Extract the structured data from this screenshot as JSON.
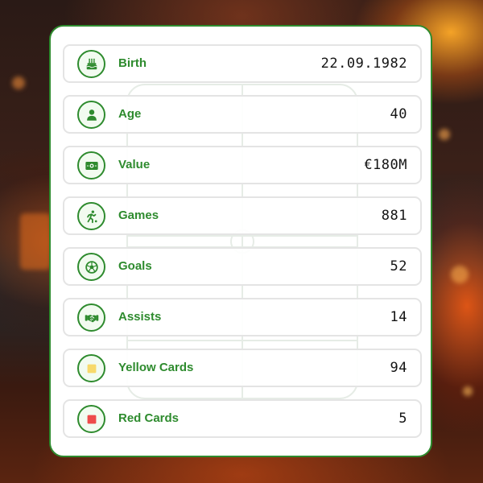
{
  "stats": [
    {
      "icon": "birthday-cake-icon",
      "label": "Birth",
      "value": "22.09.1982"
    },
    {
      "icon": "person-icon",
      "label": "Age",
      "value": "40"
    },
    {
      "icon": "money-icon",
      "label": "Value",
      "value": "€180M"
    },
    {
      "icon": "running-player-icon",
      "label": "Games",
      "value": "881"
    },
    {
      "icon": "soccer-ball-icon",
      "label": "Goals",
      "value": "52"
    },
    {
      "icon": "handshake-icon",
      "label": "Assists",
      "value": "14"
    },
    {
      "icon": "yellow-card-icon",
      "label": "Yellow Cards",
      "value": "94"
    },
    {
      "icon": "red-card-icon",
      "label": "Red Cards",
      "value": "5"
    }
  ],
  "colors": {
    "accent": "#2e8b2e",
    "value_text": "#141414",
    "yellow_card": "#f7d96a",
    "red_card": "#ee4b4b",
    "card_border": "#2e8b2e"
  }
}
